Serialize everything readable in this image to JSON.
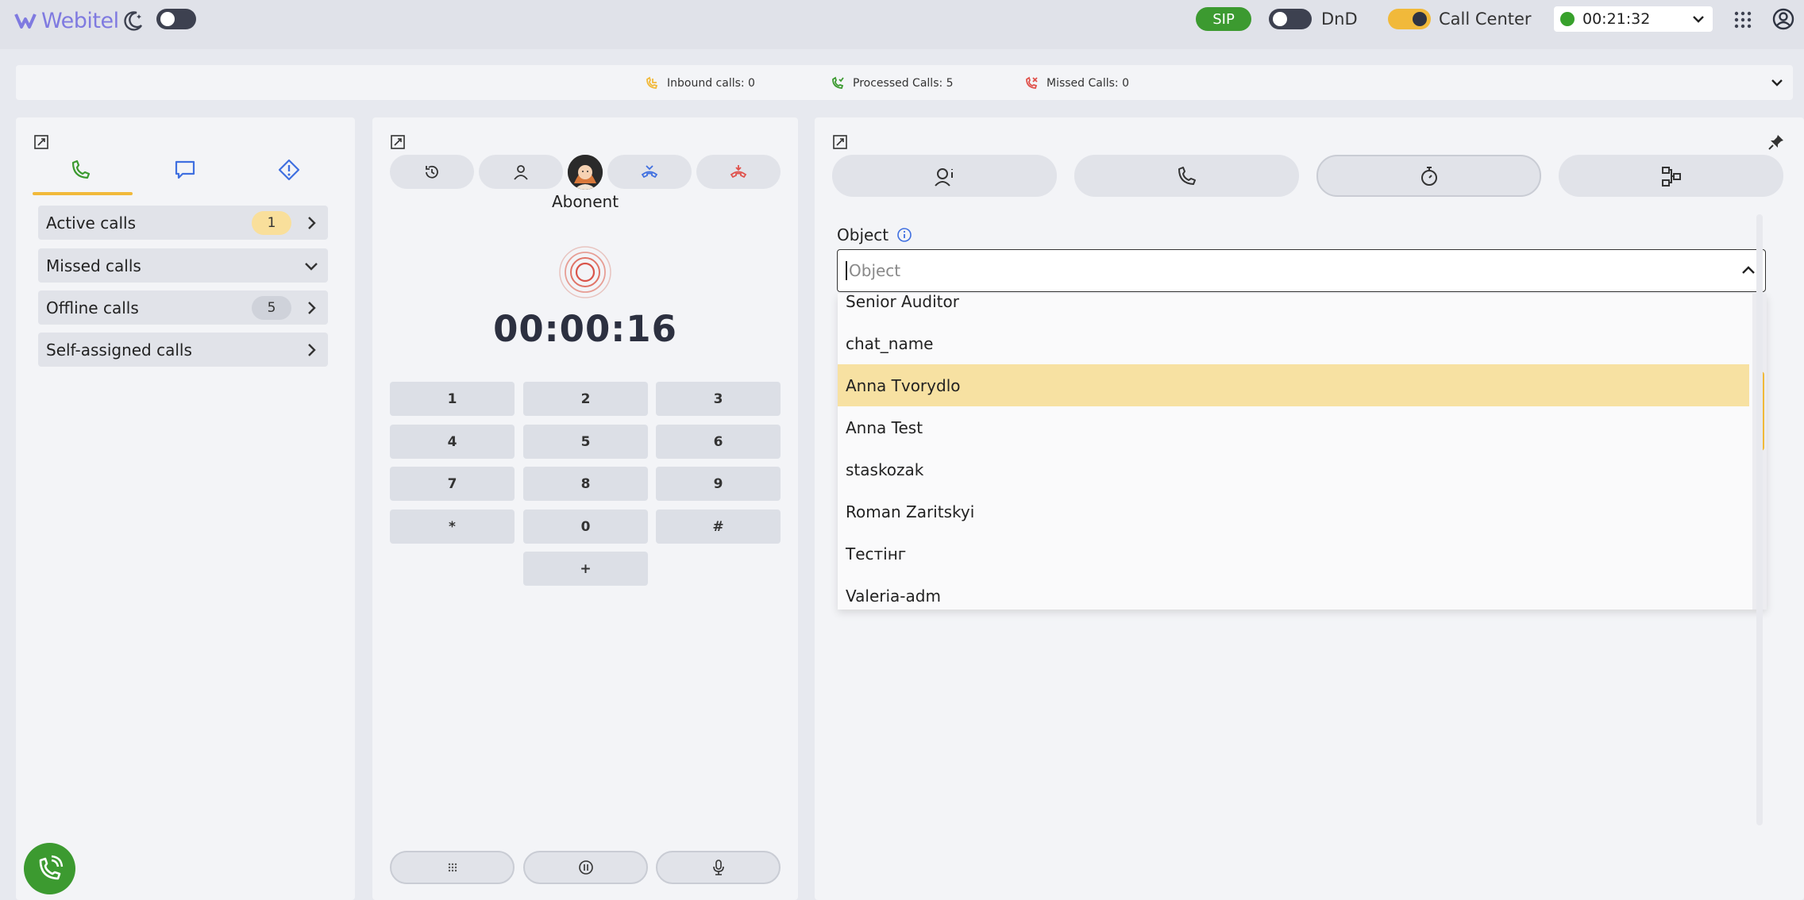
{
  "header": {
    "logo_text": "Webitel",
    "sip_label": "SIP",
    "dnd_label": "DnD",
    "call_center_label": "Call Center",
    "status_timer": "00:21:32",
    "colors": {
      "accent": "#f1b93a",
      "sip": "#3c9a30",
      "logo": "#7f7ae0"
    }
  },
  "stats": {
    "inbound": "Inbound calls: 0",
    "processed": "Processed Calls: 5",
    "missed": "Missed Calls: 0"
  },
  "queues": [
    {
      "label": "Active calls",
      "count": "1"
    },
    {
      "label": "Missed calls"
    },
    {
      "label": "Offline calls",
      "count": "5"
    },
    {
      "label": "Self-assigned calls"
    }
  ],
  "call": {
    "contact_name": "Abonent",
    "duration": "00:00:16"
  },
  "keypad": [
    "1",
    "2",
    "3",
    "4",
    "5",
    "6",
    "7",
    "8",
    "9",
    "*",
    "0",
    "#",
    "+"
  ],
  "object_field": {
    "label": "Object",
    "placeholder": "Object",
    "options": [
      "Senior Auditor",
      "chat_name",
      "Anna Tvorydlo",
      "Anna Test",
      "staskozak",
      "Roman Zaritskyi",
      "Тестінг",
      "Valeria-adm"
    ],
    "highlighted": "Anna Tvorydlo"
  }
}
